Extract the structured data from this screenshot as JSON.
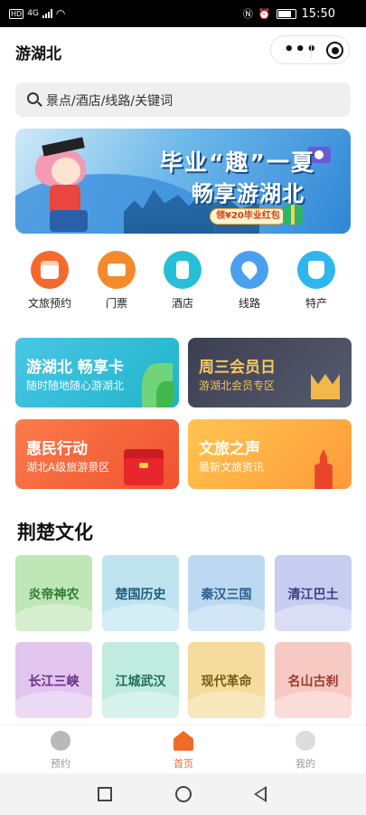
{
  "status_bar": {
    "left_badge": "HD",
    "network": "4G",
    "time": "15:50"
  },
  "header": {
    "title": "游湖北",
    "menu_dots": "•••"
  },
  "search": {
    "placeholder": "景点/酒店/线路/关键词"
  },
  "banner": {
    "headline": "毕业“趣”一夏",
    "subline": "畅享游湖北",
    "coupon": "领¥20毕业红包"
  },
  "categories": [
    {
      "label": "文旅预约",
      "color": "#f56a2c",
      "icon": "calendar-icon"
    },
    {
      "label": "门票",
      "color": "#f58a2a",
      "icon": "ticket-icon"
    },
    {
      "label": "酒店",
      "color": "#27bfd8",
      "icon": "hotel-icon"
    },
    {
      "label": "线路",
      "color": "#4aa0ef",
      "icon": "location-pin-icon"
    },
    {
      "label": "特产",
      "color": "#2eb6ee",
      "icon": "bag-icon"
    }
  ],
  "feature_cards": [
    {
      "title": "游湖北 畅享卡",
      "subtitle": "随时随地随心游湖北",
      "bg": "linear-gradient(135deg,#49c6e6,#1fb4c9)"
    },
    {
      "title": "周三会员日",
      "subtitle": "游湖北会员专区",
      "bg": "linear-gradient(135deg,#3c3f52,#575b6e)",
      "title_color": "#f6c860",
      "sub_color": "#f6c860"
    },
    {
      "title": "惠民行动",
      "subtitle": "湖北A级旅游景区",
      "bg": "linear-gradient(135deg,#fb7b4c,#f0522f)"
    },
    {
      "title": "文旅之声",
      "subtitle": "最新文旅资讯",
      "bg": "linear-gradient(135deg,#ffc54f,#ff9a3a)"
    }
  ],
  "culture": {
    "section_title": "荆楚文化",
    "tiles": [
      {
        "label": "炎帝神农",
        "bg": "#bfe6b6",
        "color": "#2e7d32"
      },
      {
        "label": "楚国历史",
        "bg": "#bfe4ef",
        "color": "#1e5c7a"
      },
      {
        "label": "秦汉三国",
        "bg": "#bcd9f1",
        "color": "#2a5f8f"
      },
      {
        "label": "清江巴土",
        "bg": "#c6cdf0",
        "color": "#3a3f80"
      },
      {
        "label": "长江三峡",
        "bg": "#e2c6ef",
        "color": "#6a2f86"
      },
      {
        "label": "江城武汉",
        "bg": "#c0ece0",
        "color": "#1f6e57"
      },
      {
        "label": "现代革命",
        "bg": "#f5dc9c",
        "color": "#7a5a1a"
      },
      {
        "label": "名山古刹",
        "bg": "#f7c9c3",
        "color": "#9b3a2f"
      }
    ]
  },
  "tabbar": [
    {
      "label": "预约",
      "active": false
    },
    {
      "label": "首页",
      "active": true
    },
    {
      "label": "我的",
      "active": false
    }
  ],
  "colors": {
    "accent": "#f26a2a",
    "inactive": "#999999"
  }
}
